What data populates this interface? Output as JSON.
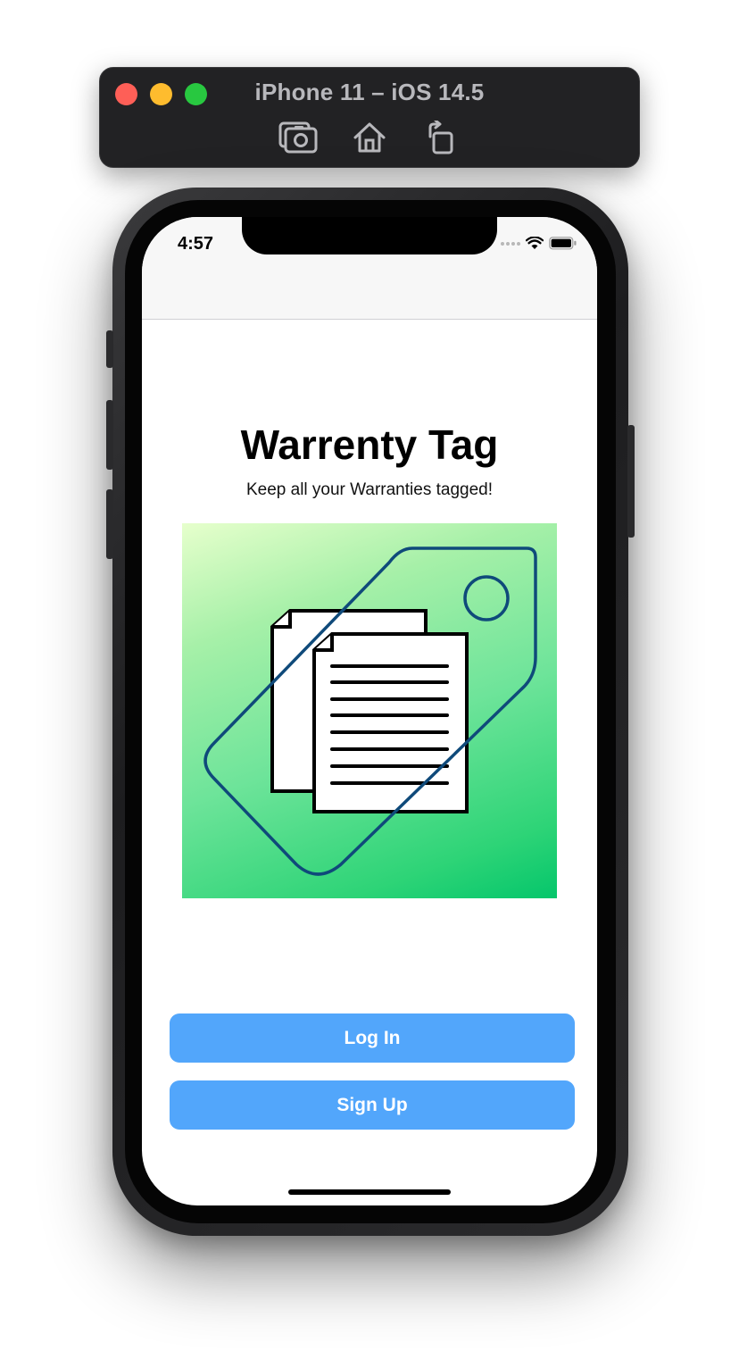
{
  "simulator": {
    "title": "iPhone 11 – iOS 14.5",
    "tools": [
      {
        "icon": "screenshot-icon"
      },
      {
        "icon": "home-icon"
      },
      {
        "icon": "rotate-icon"
      }
    ]
  },
  "status_bar": {
    "time": "4:57"
  },
  "app": {
    "title": "Warrenty Tag",
    "subtitle": "Keep all your Warranties tagged!",
    "logo_icon": "warranty-tag-logo-icon"
  },
  "buttons": {
    "login_label": "Log In",
    "signup_label": "Sign Up"
  },
  "colors": {
    "button": "#52a6fb",
    "tag_outline": "#0f4a7a",
    "logo_gradient_start": "#e6ffcc",
    "logo_gradient_end": "#05c66b"
  }
}
